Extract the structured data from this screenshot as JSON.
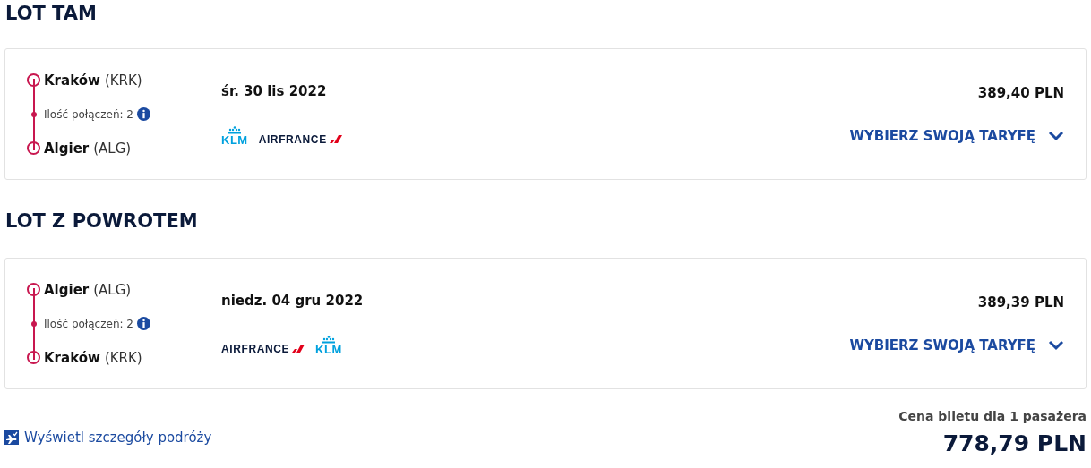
{
  "sections": [
    {
      "title": "LOT TAM",
      "from": {
        "city": "Kraków",
        "code": "(KRK)"
      },
      "stops": "Ilość połączeń: 2",
      "to": {
        "city": "Algier",
        "code": "(ALG)"
      },
      "date": "śr. 30 lis 2022",
      "airlines": [
        {
          "kind": "klm",
          "name": "KLM"
        },
        {
          "kind": "airfrance",
          "name": "AIRFRANCE"
        }
      ],
      "price": "389,40 PLN",
      "fare_button": "WYBIERZ SWOJĄ TARYFĘ",
      "expanded": false
    },
    {
      "title": "LOT Z POWROTEM",
      "from": {
        "city": "Algier",
        "code": "(ALG)"
      },
      "stops": "Ilość połączeń: 2",
      "to": {
        "city": "Kraków",
        "code": "(KRK)"
      },
      "date": "niedz. 04 gru 2022",
      "airlines": [
        {
          "kind": "airfrance",
          "name": "AIRFRANCE"
        },
        {
          "kind": "klm",
          "name": "KLM"
        }
      ],
      "price": "389,39 PLN",
      "fare_button": "WYBIERZ SWOJĄ TARYFĘ",
      "expanded": false
    }
  ],
  "footer": {
    "details_link": "Wyświetl szczegóły podróży",
    "price_label": "Cena biletu dla 1 pasażera",
    "total": "778,79 PLN"
  }
}
